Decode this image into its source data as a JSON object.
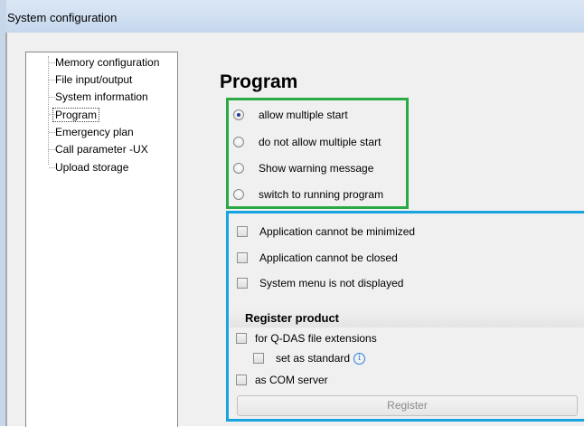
{
  "window": {
    "title": "System configuration"
  },
  "tree": {
    "items": [
      {
        "label": "Memory configuration",
        "selected": false
      },
      {
        "label": "File input/output",
        "selected": false
      },
      {
        "label": "System information",
        "selected": false
      },
      {
        "label": "Program",
        "selected": true
      },
      {
        "label": "Emergency plan",
        "selected": false
      },
      {
        "label": "Call parameter  -UX",
        "selected": false
      },
      {
        "label": "Upload storage",
        "selected": false
      }
    ]
  },
  "main": {
    "title": "Program",
    "start_options": [
      {
        "label": "allow multiple start",
        "checked": true
      },
      {
        "label": "do not allow multiple start",
        "checked": false
      },
      {
        "label": "Show warning message",
        "checked": false
      },
      {
        "label": "switch to running program",
        "checked": false
      }
    ],
    "app_options": [
      {
        "label": "Application cannot be minimized",
        "checked": false
      },
      {
        "label": "Application cannot be closed",
        "checked": false
      },
      {
        "label": "System menu is not displayed",
        "checked": false
      }
    ],
    "register": {
      "header": "Register product",
      "qdas_label": "for Q-DAS file extensions",
      "standard_label": "set as standard",
      "com_label": "as COM server",
      "button_label": "Register"
    }
  },
  "colors": {
    "radio_group_border": "#2aaa45",
    "check_group_border": "#17a4e0"
  }
}
